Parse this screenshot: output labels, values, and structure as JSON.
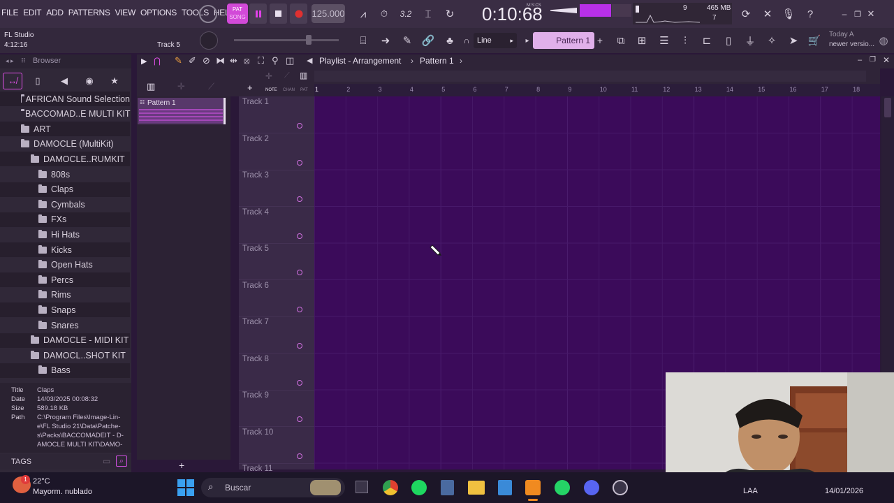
{
  "menu": {
    "items": [
      "FILE",
      "EDIT",
      "ADD",
      "PATTERNS",
      "VIEW",
      "OPTIONS",
      "TOOLS",
      "HELP"
    ]
  },
  "transport": {
    "mode_top": "PAT",
    "mode_bottom": "SONG",
    "tempo": "125.000",
    "time": "0:10:68",
    "time_unit": "M:S:CS",
    "cpu_voices": "9",
    "memory": "465 MB",
    "polyphony": "7"
  },
  "hint": {
    "app": "FL Studio",
    "position": "4:12:16",
    "track": "Track 5"
  },
  "toolbar": {
    "snap": "Line",
    "pattern": "Pattern 1",
    "news_line1": "Today",
    "news_line1b": "A",
    "news_line2": "newer versio..."
  },
  "browser": {
    "title": "Browser",
    "items": [
      {
        "label": "AFRICAN Sound Selection",
        "level": 0
      },
      {
        "label": "BACCOMAD..E MULTI KIT",
        "level": 0
      },
      {
        "label": "ART",
        "level": 1
      },
      {
        "label": "DAMOCLE (MultiKit)",
        "level": 1
      },
      {
        "label": "DAMOCLE..RUMKIT",
        "level": 2
      },
      {
        "label": "808s",
        "level": 3
      },
      {
        "label": "Claps",
        "level": 3
      },
      {
        "label": "Cymbals",
        "level": 3
      },
      {
        "label": "FXs",
        "level": 3
      },
      {
        "label": "Hi Hats",
        "level": 3
      },
      {
        "label": "Kicks",
        "level": 3
      },
      {
        "label": "Open Hats",
        "level": 3
      },
      {
        "label": "Percs",
        "level": 3
      },
      {
        "label": "Rims",
        "level": 3
      },
      {
        "label": "Snaps",
        "level": 3
      },
      {
        "label": "Snares",
        "level": 3
      },
      {
        "label": "DAMOCLE - MIDI KIT",
        "level": 2
      },
      {
        "label": "DAMOCL..SHOT KIT",
        "level": 2
      },
      {
        "label": "Bass",
        "level": 3
      }
    ]
  },
  "info": {
    "title_k": "Title",
    "title_v": "Claps",
    "date_k": "Date",
    "date_v": "14/03/2025 00:08:32",
    "size_k": "Size",
    "size_v": "589.18 KB",
    "path_k": "Path",
    "path_v1": "C:\\Program Files\\Image-Lin-",
    "path_v2": "e\\FL Studio 21\\Data\\Patche-",
    "path_v3": "s\\Packs\\BACCOMADEIT - D-",
    "path_v4": "AMOCLE MULTI KIT\\DAMO-",
    "tags": "TAGS"
  },
  "playlist": {
    "title": "Playlist - Arrangement",
    "pattern": "Pattern 1",
    "pattern_clip": "Pattern 1",
    "tool_labels": [
      "NOTE",
      "CHAN",
      "PAT"
    ],
    "ruler": [
      "1",
      "2",
      "3",
      "4",
      "5",
      "6",
      "7",
      "8",
      "9",
      "10",
      "11",
      "12",
      "13",
      "14",
      "15",
      "16",
      "17",
      "18"
    ],
    "tracks": [
      "Track 1",
      "Track 2",
      "Track 3",
      "Track 4",
      "Track 5",
      "Track 6",
      "Track 7",
      "Track 8",
      "Track 9",
      "Track 10",
      "Track 11"
    ]
  },
  "taskbar": {
    "temp": "22°C",
    "weather": "Mayorm. nublado",
    "search": "Buscar",
    "lang": "LAA",
    "date": "14/01/2026",
    "notif": "1"
  },
  "colors": {
    "grid": "#3b0b5a",
    "accent": "#c060e0",
    "record": "#e03030"
  }
}
